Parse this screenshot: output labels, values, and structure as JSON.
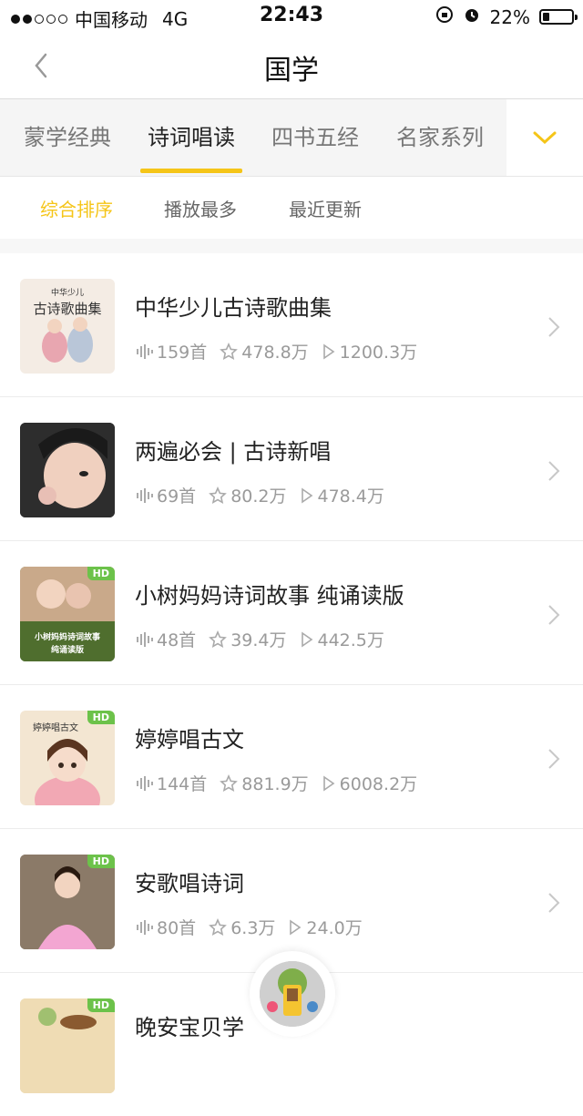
{
  "status_bar": {
    "carrier": "中国移动",
    "network": "4G",
    "time": "22:43",
    "battery": "22%"
  },
  "nav": {
    "title": "国学"
  },
  "categories": [
    {
      "label": "蒙学经典",
      "active": false
    },
    {
      "label": "诗词唱读",
      "active": true
    },
    {
      "label": "四书五经",
      "active": false
    },
    {
      "label": "名家系列",
      "active": false
    }
  ],
  "sort_tabs": [
    {
      "label": "综合排序",
      "active": true
    },
    {
      "label": "播放最多",
      "active": false
    },
    {
      "label": "最近更新",
      "active": false
    }
  ],
  "albums": [
    {
      "title": "中华少儿古诗歌曲集",
      "tracks": "159首",
      "favorites": "478.8万",
      "plays": "1200.3万",
      "hd": false,
      "cover_text_1": "中华少儿",
      "cover_text_2": "古诗歌曲集"
    },
    {
      "title": "两遍必会 | 古诗新唱",
      "tracks": "69首",
      "favorites": "80.2万",
      "plays": "478.4万",
      "hd": false
    },
    {
      "title": "小树妈妈诗词故事 纯诵读版",
      "tracks": "48首",
      "favorites": "39.4万",
      "plays": "442.5万",
      "hd": true,
      "hd_label": "HD",
      "cover_text_1": "小树妈妈诗词故事",
      "cover_text_2": "纯诵读版"
    },
    {
      "title": "婷婷唱古文",
      "tracks": "144首",
      "favorites": "881.9万",
      "plays": "6008.2万",
      "hd": true,
      "hd_label": "HD",
      "cover_text_1": "婷婷唱古文"
    },
    {
      "title": "安歌唱诗词",
      "tracks": "80首",
      "favorites": "6.3万",
      "plays": "24.0万",
      "hd": true,
      "hd_label": "HD"
    },
    {
      "title": "晚安宝贝学",
      "hd": true,
      "hd_label": "HD"
    }
  ],
  "colors": {
    "accent": "#f5c518",
    "muted": "#9a9a9a",
    "hd_badge": "#6cc24a"
  }
}
